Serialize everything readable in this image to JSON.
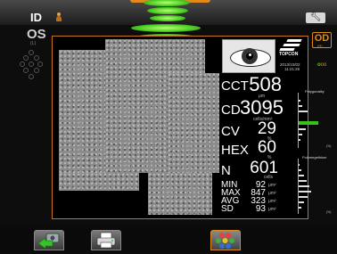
{
  "header": {
    "id_label": "ID",
    "wrench_icon": "wrench-icon",
    "person_icon": "person-icon"
  },
  "left_eye": {
    "label": "OS",
    "sublabel": "(L)"
  },
  "right_eye": {
    "label": "OD",
    "sublabel": "(R)",
    "indicator": "oo",
    "active_indicator": "o"
  },
  "device": {
    "brand": "TOPCON",
    "date": "2013/10/02",
    "time": "11:21:26"
  },
  "measurements": {
    "cct": {
      "label": "CCT",
      "value": "508",
      "unit": "μm"
    },
    "cd": {
      "label": "CD",
      "value": "3095",
      "unit": "cells/mm²"
    },
    "cv": {
      "label": "CV",
      "value": "29",
      "unit": "%"
    },
    "hex": {
      "label": "HEX",
      "value": "60",
      "unit": "%"
    },
    "n": {
      "label": "N",
      "value": "601",
      "unit": "cells"
    },
    "min": {
      "label": "MIN",
      "value": "92",
      "unit": "μm²"
    },
    "max": {
      "label": "MAX",
      "value": "847",
      "unit": "μm²"
    },
    "avg": {
      "label": "AVG",
      "value": "323",
      "unit": "μm²"
    },
    "sd": {
      "label": "SD",
      "value": "93",
      "unit": "μm²"
    }
  },
  "histograms": {
    "polygonality": {
      "title": "Polygonality",
      "percent_label": "(%)"
    },
    "polymegethism": {
      "title": "Polymegethism",
      "percent_label": "(%)"
    }
  },
  "toolbar": {
    "back_icon": "back-arrow-icon",
    "print_icon": "printer-icon",
    "analysis_icon": "cell-analysis-icon"
  },
  "colors": {
    "accent": "#e08a1c",
    "focus_green": "#39c21c",
    "background": "#0d0d0d"
  }
}
